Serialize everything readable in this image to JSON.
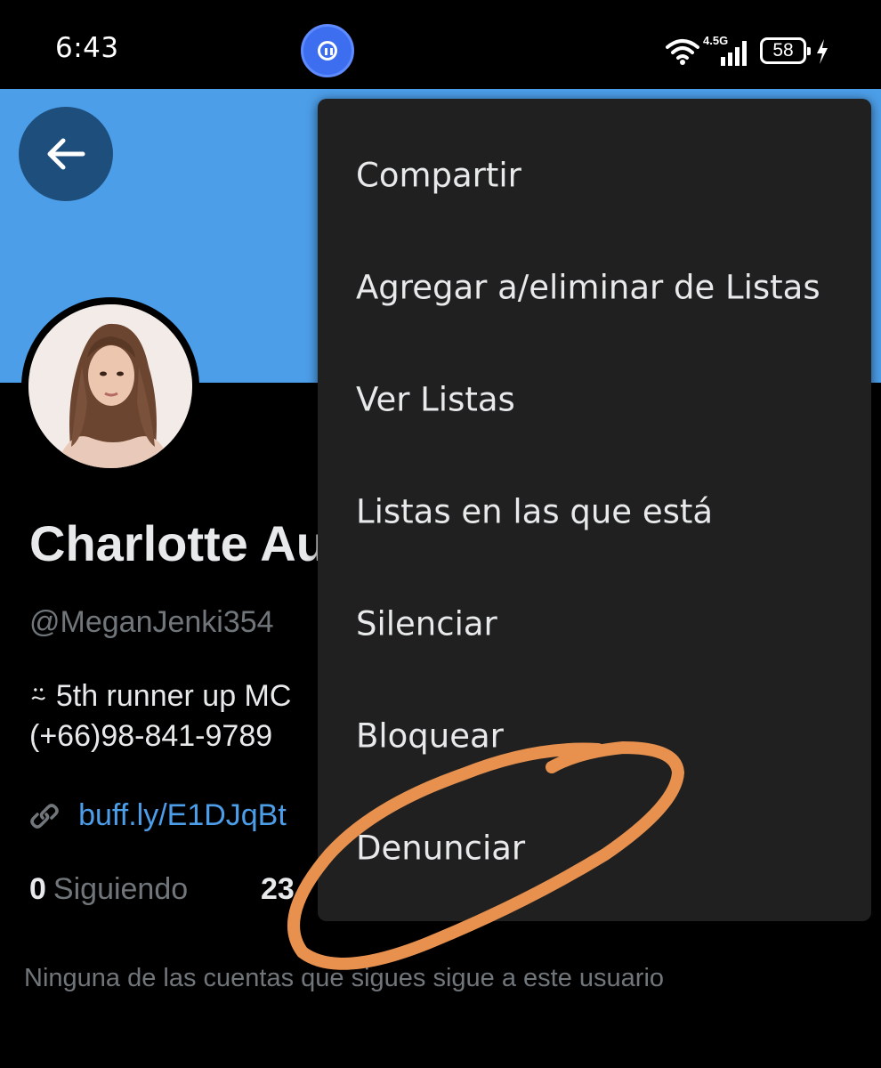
{
  "status_bar": {
    "time": "6:43",
    "network": "4.5G",
    "battery": "58"
  },
  "profile": {
    "name": "Charlotte Au",
    "handle": "@MeganJenki354",
    "bio_line1": "⍨ 5th runner up MC",
    "bio_line2": "(+66)98-841-9789",
    "link": "buff.ly/E1DJqBt",
    "following_count": "0",
    "following_label": "Siguiendo",
    "followers_count_partial": "23",
    "no_mutuals_text": "Ninguna de las cuentas que sigues sigue a este usuario"
  },
  "menu": {
    "items": [
      {
        "label": "Compartir"
      },
      {
        "label": "Agregar a/eliminar de Listas"
      },
      {
        "label": "Ver Listas"
      },
      {
        "label": "Listas en las que está"
      },
      {
        "label": "Silenciar"
      },
      {
        "label": "Bloquear"
      },
      {
        "label": "Denunciar"
      }
    ]
  },
  "colors": {
    "banner": "#4c9ee9",
    "menu_bg": "#202020",
    "annotation": "#e8914f",
    "link": "#4c9ee9"
  },
  "icons": {
    "back": "arrow-left-icon",
    "link": "link-icon",
    "screen_record": "pause-icon",
    "wifi": "wifi-icon",
    "signal": "signal-icon",
    "battery": "battery-icon",
    "charging": "bolt-icon"
  }
}
